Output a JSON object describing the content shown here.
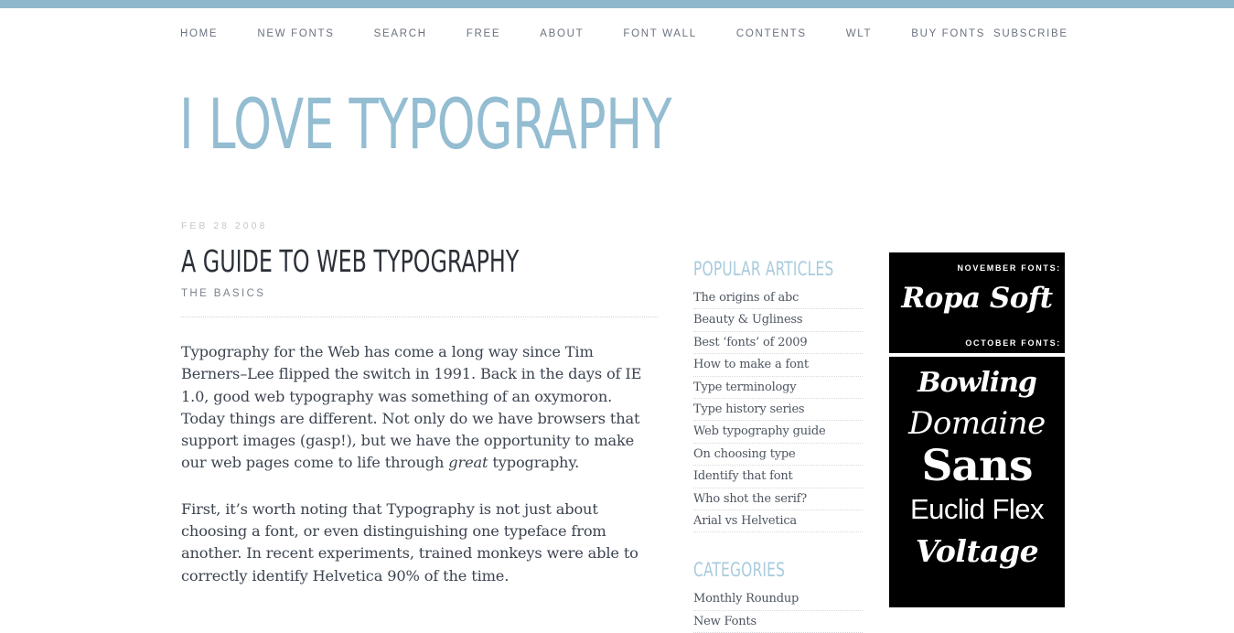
{
  "theme": {
    "accent_bar_color": "#8fb8cc",
    "logo_color": "#94bdd2",
    "heading_color": "#a8cbdd",
    "body_text_color": "#3c4450",
    "nav_text_color": "#6b7280"
  },
  "nav": {
    "items": [
      {
        "label": "HOME"
      },
      {
        "label": "NEW FONTS"
      },
      {
        "label": "SEARCH"
      },
      {
        "label": "FREE"
      },
      {
        "label": "ABOUT"
      },
      {
        "label": "FONT WALL"
      },
      {
        "label": "CONTENTS"
      },
      {
        "label": "WLT"
      },
      {
        "label": "BUY FONTS"
      }
    ],
    "subscribe_label": "SUBSCRIBE"
  },
  "site": {
    "title": "I LOVE TYPOGRAPHY"
  },
  "article": {
    "date": "FEB 28 2008",
    "title": "A GUIDE TO WEB TYPOGRAPHY",
    "subtitle": "THE BASICS",
    "paragraph_1_part_1": "Typography for the Web has come a long way since Tim Berners–Lee flipped the switch in 1991. Back in the days of IE 1.0, good web typography was something of an oxymoron. Today things are different. Not only do we have browsers that support images (gasp!), but we have the opportunity to make our web pages come to life through ",
    "paragraph_1_emphasis": "great",
    "paragraph_1_part_2": " typography.",
    "paragraph_2": "First, it’s worth noting that Typography is not just about choosing a font, or even distinguishing one typeface from another. In recent experiments, trained monkeys were able to correctly identify Helvetica 90% of the time."
  },
  "sidebar": {
    "popular_heading": "POPULAR ARTICLES",
    "popular_items": [
      {
        "label": "The origins of abc"
      },
      {
        "label": "Beauty & Ugliness"
      },
      {
        "label": "Best ‘fonts’ of 2009"
      },
      {
        "label": "How to make a font"
      },
      {
        "label": "Type terminology"
      },
      {
        "label": "Type history series"
      },
      {
        "label": "Web typography guide"
      },
      {
        "label": "On choosing type"
      },
      {
        "label": "Identify that font"
      },
      {
        "label": "Who shot the serif?"
      },
      {
        "label": "Arial vs Helvetica"
      }
    ],
    "categories_heading": "CATEGORIES",
    "categories_items": [
      {
        "label": "Monthly Roundup"
      },
      {
        "label": "New Fonts"
      }
    ]
  },
  "promo": {
    "panel_one": {
      "top_label": "NOVEMBER FONTS:",
      "feature_name": "Ropa Soft",
      "bottom_label": "OCTOBER FONTS:"
    },
    "panel_two": {
      "fonts": [
        {
          "name": "Bowling"
        },
        {
          "name": "Domaine"
        },
        {
          "name": "Sans"
        },
        {
          "name": "Euclid Flex"
        },
        {
          "name": "Voltage"
        }
      ]
    }
  }
}
